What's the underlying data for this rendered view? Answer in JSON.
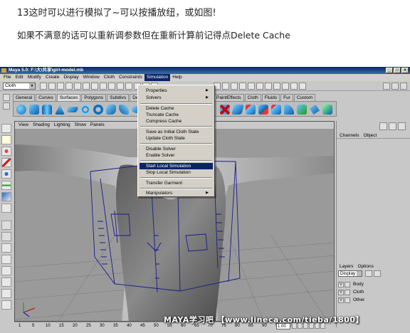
{
  "article": {
    "line1": "13这时可以进行模拟了~可以按播放纽，或如图!",
    "line2": "如果不满意的话可以重新调参数但在重新计算前记得点Delete Cache"
  },
  "window": {
    "title": "Maya 5.0: F:\\大\\共享\\girl-model.mb"
  },
  "menubar": [
    "File",
    "Edit",
    "Modify",
    "Create",
    "Display",
    "Window",
    "Cloth",
    "Constraints",
    "Simulation",
    "Help"
  ],
  "active_menu": "Simulation",
  "mode_select": "Cloth",
  "shelf_tabs": [
    "General",
    "Curves",
    "Surfaces",
    "Polygons",
    "Subdivs",
    "Deformatio"
  ],
  "shelf_tabs_right": [
    "PaintEffects",
    "Cloth",
    "Fluids",
    "Fur",
    "Custom"
  ],
  "selected_shelf_tab": "Surfaces",
  "panel_menu": [
    "View",
    "Shading",
    "Lighting",
    "Show",
    "Panels"
  ],
  "simulation_menu": [
    {
      "label": "Properties",
      "submenu": true
    },
    {
      "label": "Solvers",
      "submenu": true
    },
    {
      "label": "Delete Cache"
    },
    {
      "label": "Truncate Cache"
    },
    {
      "label": "Compress Cache"
    },
    {
      "label": "Save as Initial Cloth State"
    },
    {
      "label": "Update Cloth State"
    },
    {
      "label": "Disable Solver"
    },
    {
      "label": "Enable Solver"
    },
    {
      "label": "Start Local Simulation",
      "highlighted": true
    },
    {
      "label": "Stop Local Simulation"
    },
    {
      "label": "Transfer Garment"
    },
    {
      "label": "Manipulators",
      "submenu": true
    }
  ],
  "channel_box": {
    "tabs": [
      "Channels",
      "Object"
    ]
  },
  "layers": {
    "tabs": [
      "Layers",
      "Options"
    ],
    "display_select": "Display",
    "items": [
      {
        "visible": "V",
        "name": "Body"
      },
      {
        "visible": "V",
        "name": "Cloth"
      },
      {
        "visible": "V",
        "name": "Other"
      }
    ]
  },
  "timeline": {
    "ticks": [
      "1",
      "5",
      "10",
      "15",
      "20",
      "25",
      "30",
      "35",
      "40",
      "45",
      "50",
      "55",
      "60",
      "65",
      "70",
      "75",
      "80",
      "85",
      "90",
      "95",
      "100"
    ],
    "current_time": "1.00"
  },
  "watermark": "MAYA学习吧 【www.lineca.com/tieba/1800】",
  "colors": {
    "titlebar": "#0a246a",
    "menu_highlight": "#0a246a",
    "viewport_bg": "#9a9a9a",
    "wireframe": "#1a1a8c"
  }
}
